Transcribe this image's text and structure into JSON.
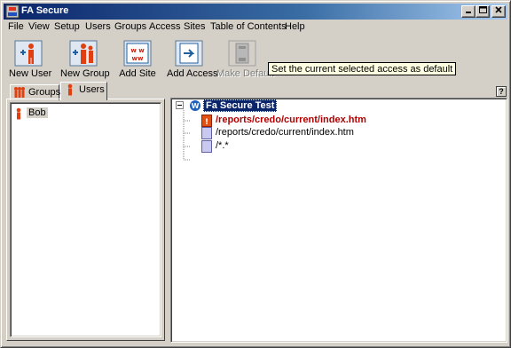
{
  "window": {
    "title": "FA Secure"
  },
  "menu": [
    "File",
    "View",
    "Setup",
    "Users",
    "Groups",
    "Access",
    "Sites",
    "Table of Contents",
    "Help"
  ],
  "toolbar": {
    "new_user": "New User",
    "new_group": "New Group",
    "add_site": "Add Site",
    "add_access": "Add Access",
    "make_default": "Make Default",
    "tooltip": "Set the current selected access as default"
  },
  "tabs": {
    "groups": "Groups",
    "users": "Users"
  },
  "users": [
    {
      "name": "Bob"
    }
  ],
  "help_button": "?",
  "tree": {
    "root": "Fa Secure Test",
    "root_badge": "W",
    "access_badge": "!",
    "children": [
      {
        "label": "/reports/credo/current/index.htm",
        "type": "default-access"
      },
      {
        "label": "/reports/credo/current/index.htm",
        "type": "page"
      },
      {
        "label": "/*.*",
        "type": "page"
      }
    ]
  },
  "colors": {
    "titlebar_start": "#0a246a",
    "titlebar_end": "#a6caf0",
    "default_access_text": "#b00000",
    "tooltip_bg": "#ffffe1",
    "selection": "#0a246a"
  }
}
